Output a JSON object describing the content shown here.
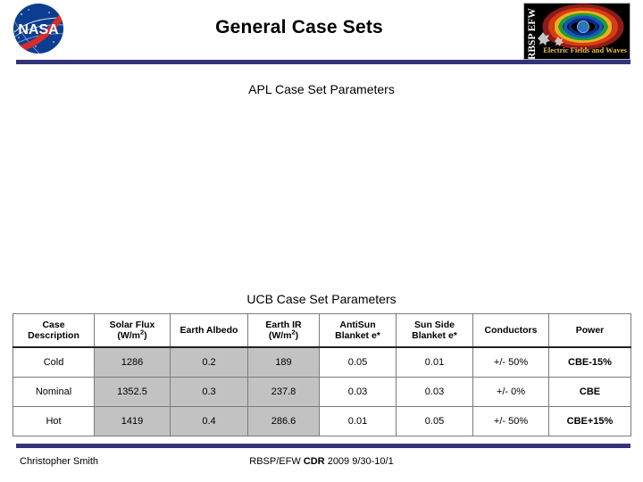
{
  "slide": {
    "title": "General Case Sets",
    "accent_color": "#33337a",
    "logos": {
      "nasa": {
        "name": "nasa-meatball-logo",
        "wordmark": "NASA"
      },
      "efw": {
        "name": "rbsp-efw-logo",
        "vertical_text": "RBSP EFW",
        "caption": "Electric Fields and Waves"
      }
    }
  },
  "sections": {
    "apl_heading": "APL Case Set Parameters",
    "ucb_heading": "UCB Case Set Parameters"
  },
  "ucb_table": {
    "headers": [
      {
        "line1": "Case",
        "line2": "Description"
      },
      {
        "line1": "Solar Flux",
        "line2": "(W/m²)"
      },
      {
        "line1": "Earth Albedo",
        "line2": ""
      },
      {
        "line1": "Earth IR",
        "line2": "(W/m²)"
      },
      {
        "line1": "AntiSun",
        "line2": "Blanket e*"
      },
      {
        "line1": "Sun Side",
        "line2": "Blanket e*"
      },
      {
        "line1": "Conductors",
        "line2": ""
      },
      {
        "line1": "Power",
        "line2": ""
      }
    ],
    "rows": [
      {
        "case_description": "Cold",
        "solar_flux": "1286",
        "earth_albedo": "0.2",
        "earth_ir": "189",
        "antisun_blanket": "0.05",
        "sun_side_blanket": "0.01",
        "conductors": "+/- 50%",
        "power": "CBE-15%"
      },
      {
        "case_description": "Nominal",
        "solar_flux": "1352.5",
        "earth_albedo": "0.3",
        "earth_ir": "237.8",
        "antisun_blanket": "0.03",
        "sun_side_blanket": "0.03",
        "conductors": "+/- 0%",
        "power": "CBE"
      },
      {
        "case_description": "Hot",
        "solar_flux": "1419",
        "earth_albedo": "0.4",
        "earth_ir": "286.6",
        "antisun_blanket": "0.01",
        "sun_side_blanket": "0.05",
        "conductors": "+/- 50%",
        "power": "CBE+15%"
      }
    ],
    "shaded_column_indexes": [
      1,
      2,
      3
    ],
    "shaded_color": "#c2c2c2"
  },
  "footer": {
    "author": "Christopher Smith",
    "center_prefix": "RBSP/EFW ",
    "center_bold": "CDR",
    "center_suffix": " 2009 9/30-10/1"
  }
}
